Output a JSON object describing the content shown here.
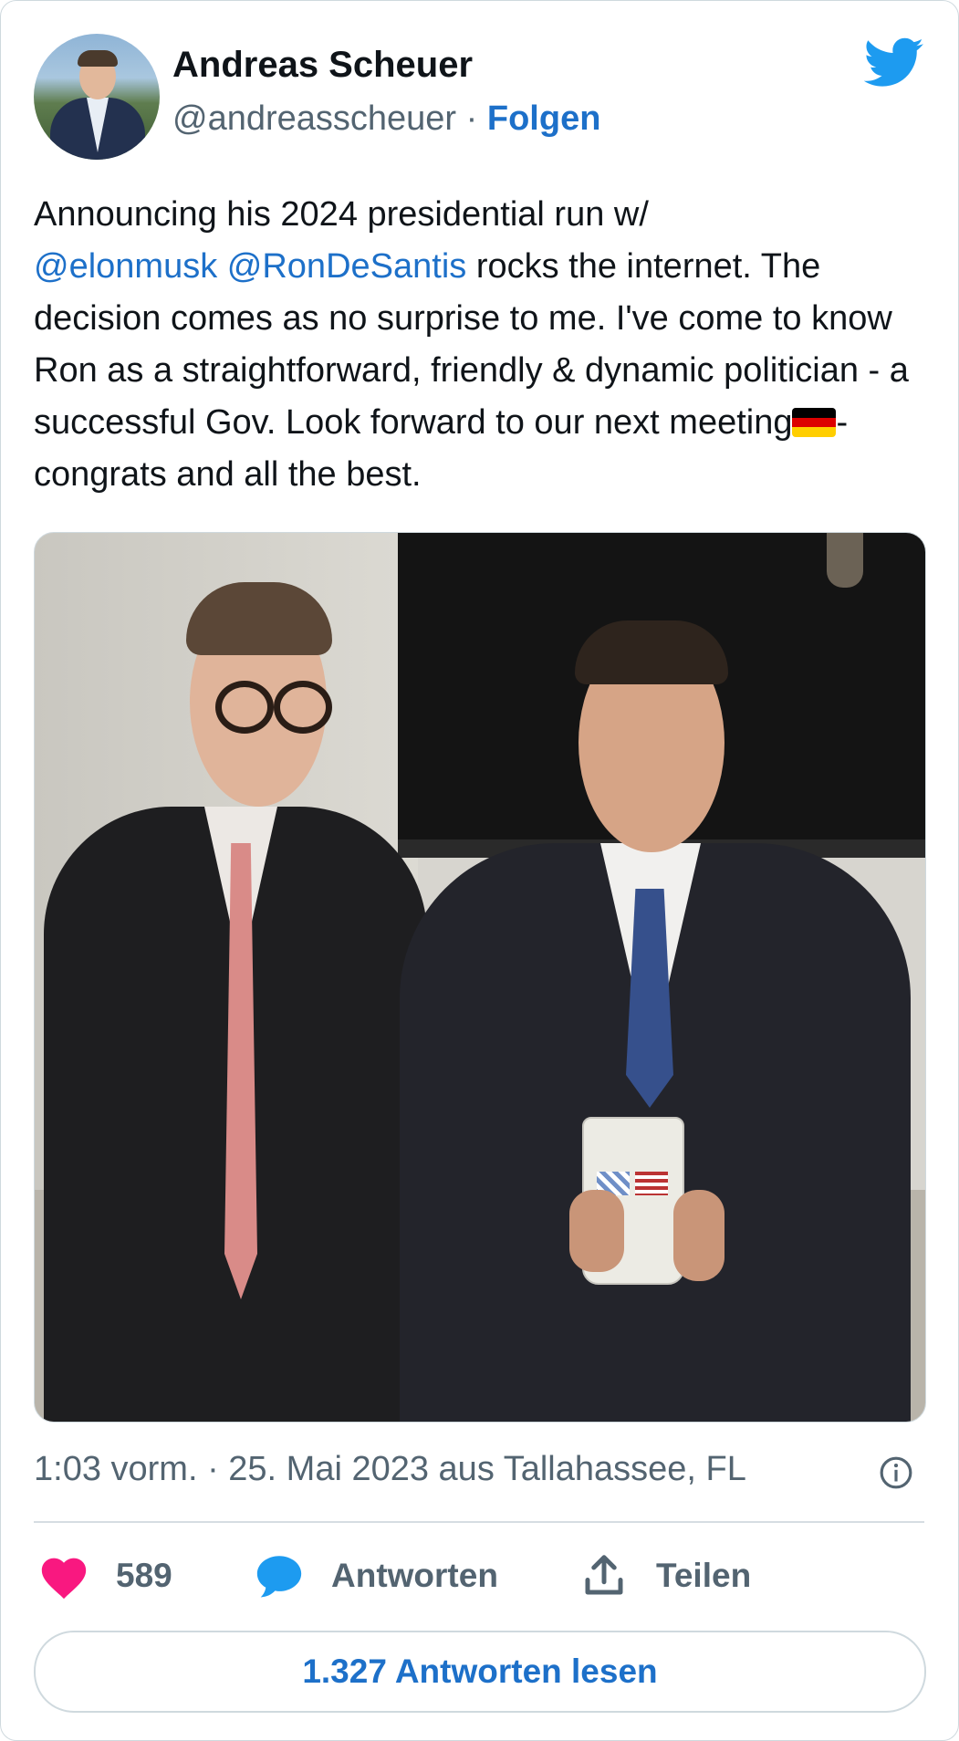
{
  "author": {
    "name": "Andreas Scheuer",
    "handle": "@andreasscheuer",
    "separator": "·",
    "follow_label": "Folgen"
  },
  "tweet": {
    "line1": "Announcing his 2024 presidential run w/",
    "mention1": "@elonmusk",
    "mention2": "@RonDeSantis",
    "after_mentions": " rocks the internet. The decision comes as no surprise to me. I've come to know Ron as a straightforward, friendly & dynamic politician - a successful Gov. Look forward to our next meeting",
    "after_flag": "- congrats and all the best."
  },
  "flag_colors": [
    "#000000",
    "#dd0000",
    "#ffce00"
  ],
  "meta": {
    "timestamp": "1:03 vorm. · 25. Mai 2023 aus Tallahassee, FL"
  },
  "actions": {
    "like_count": "589",
    "reply_label": "Antworten",
    "share_label": "Teilen"
  },
  "read_replies_label": "1.327 Antworten lesen",
  "icons": [
    "twitter-bird-icon",
    "info-icon",
    "heart-icon",
    "reply-bubble-icon",
    "share-icon"
  ],
  "colors": {
    "link": "#1d70c9",
    "twitter_blue": "#1d9bf0",
    "like": "#f91880",
    "secondary_text": "#536471"
  }
}
